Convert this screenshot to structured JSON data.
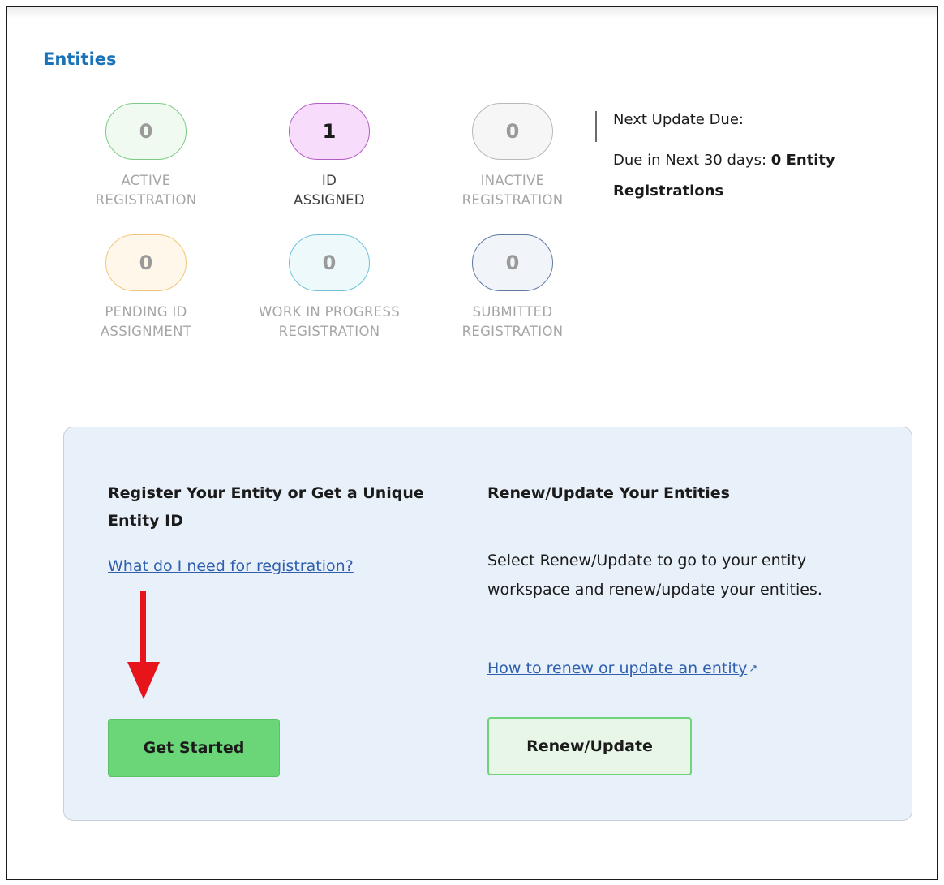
{
  "section": {
    "title": "Entities"
  },
  "stats": [
    {
      "key": "active",
      "count": "0",
      "label": "ACTIVE\nREGISTRATION"
    },
    {
      "key": "assigned",
      "count": "1",
      "label": "ID\nASSIGNED"
    },
    {
      "key": "inactive",
      "count": "0",
      "label": "INACTIVE\nREGISTRATION"
    },
    {
      "key": "pending",
      "count": "0",
      "label": "PENDING ID\nASSIGNMENT"
    },
    {
      "key": "wip",
      "count": "0",
      "label": "WORK IN PROGRESS\nREGISTRATION"
    },
    {
      "key": "submitted",
      "count": "0",
      "label": "SUBMITTED\nREGISTRATION"
    }
  ],
  "next_update": {
    "heading": "Next Update Due:",
    "prefix": "Due in Next 30 days: ",
    "value": "0 Entity Registrations"
  },
  "register": {
    "title": "Register Your Entity or Get a Unique Entity ID",
    "link": "What do I need for registration?",
    "button": "Get Started"
  },
  "renew": {
    "title": "Renew/Update Your Entities",
    "description": "Select Renew/Update to go to your entity workspace and renew/update your entities.",
    "link": "How to renew or update an entity",
    "button": "Renew/Update"
  },
  "colors": {
    "accent": "#1a73b8",
    "arrow": "#e8141c",
    "primary_button": "#6bd678",
    "panel_bg": "#e8f0f9"
  },
  "icons": {
    "external_link": "external-link-icon",
    "annotation_arrow": "red-arrow-icon"
  }
}
